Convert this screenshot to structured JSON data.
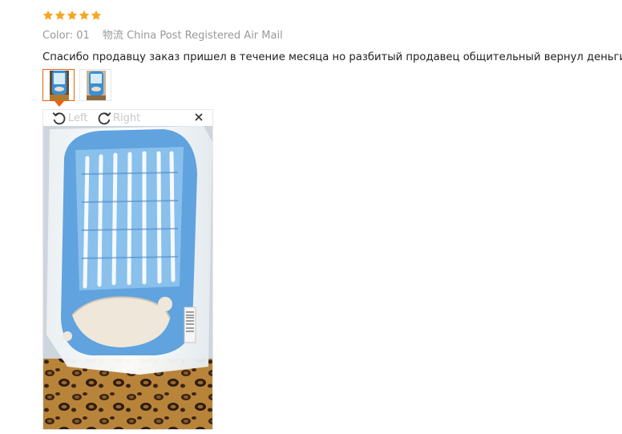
{
  "review": {
    "rating": 5,
    "rating_max": 5,
    "star_color": "#f5a623",
    "color_label": "Color:",
    "color_value": "01",
    "shipping_label": "物流",
    "shipping_value": "China Post Registered Air Mail",
    "comment": "Спасибо продавцу заказ пришел в течение месяца но разбитый продавец общительный вернул деньги"
  },
  "gallery": {
    "selected_index": 0,
    "thumbnail_count": 2,
    "active_border_color": "#e96112"
  },
  "viewer": {
    "rotate_left_label": "Left",
    "rotate_right_label": "Right",
    "close_icon": "close-icon"
  }
}
